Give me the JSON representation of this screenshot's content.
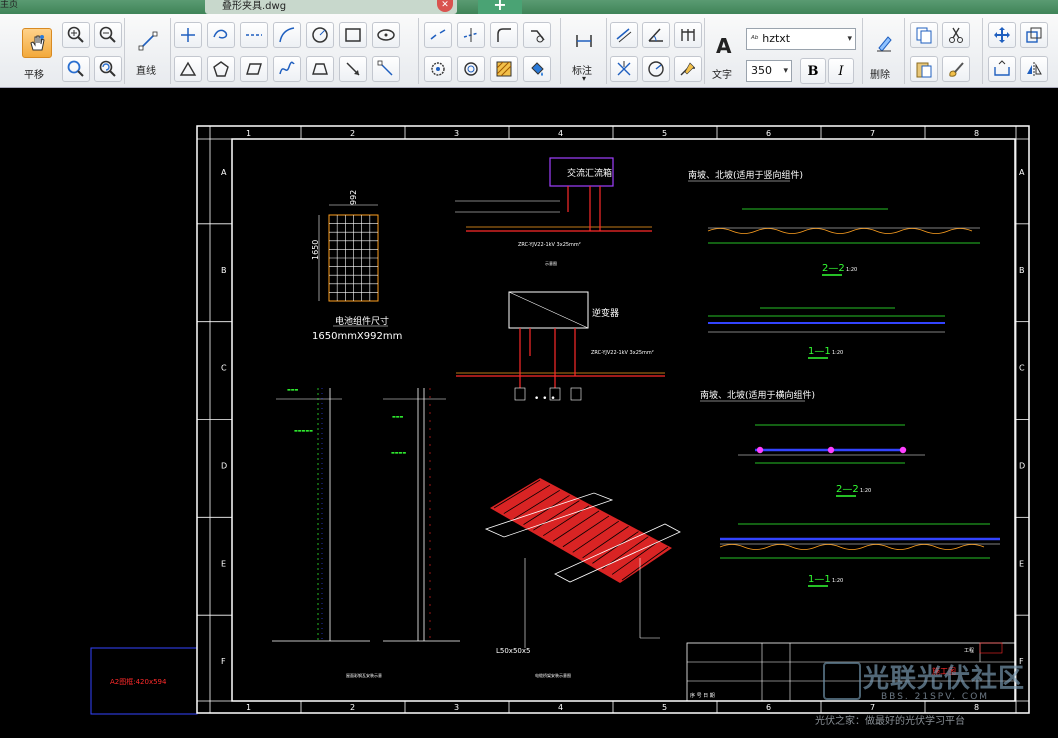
{
  "window": {
    "left_text": "主页",
    "tab_title": "叠形夹具.dwg",
    "close_icon": "close-icon",
    "new_tab_icon": "plus-icon"
  },
  "ribbon": {
    "pan_label": "平移",
    "line_label": "直线",
    "dimension_label": "标注",
    "text_label": "文字",
    "delete_label": "删除",
    "text_style": "hztxt",
    "text_height": "350",
    "bold_label": "B",
    "italic_label": "I"
  },
  "drawing": {
    "col_labels": [
      "1",
      "2",
      "3",
      "4",
      "5",
      "6",
      "7",
      "8"
    ],
    "row_labels": [
      "A",
      "B",
      "C",
      "D",
      "E",
      "F"
    ],
    "panel_dim_width": "992",
    "panel_dim_height": "1650",
    "panel_title": "电池组件尺寸",
    "panel_size": "1650mmX992mm",
    "combiner_label": "交流汇流箱",
    "inverter_label": "逆变器",
    "south_north_longitudinal": "南坡、北坡(适用于竖向组件)",
    "south_north_transverse": "南坡、北坡(适用于横向组件)",
    "section_2_2": "2—2",
    "section_1_1": "1—1",
    "scale_1_20": "1:20",
    "frame_size_label": "A2图框:420x594",
    "cable_1": "ZRC-YJV22-1kV 3x25mm²",
    "cable_2": "ZRC-YJV22-1kV 3x25mm²",
    "angle_label": "L50x50x5",
    "mounting_caption": "屋面彩钢瓦安装示意",
    "tray_caption": "电缆桥架安装示意图",
    "title_block_label": "工程",
    "stamp": "施工图"
  },
  "watermark": {
    "logo_text": "光联光伏社区",
    "url": "BBS. 21SPV. COM",
    "slogan": "光伏之家：做最好的光伏学习平台"
  },
  "colors": {
    "ribbon_bg": "#f0f2f5",
    "canvas_bg": "#000000",
    "title_bar": "#4f9366",
    "cad_red": "#ff2a2a",
    "cad_green": "#33ff33",
    "cad_blue": "#3344ff",
    "cad_orange": "#ffa020",
    "cad_magenta": "#ff40ff",
    "cad_purple_box": "#a040ff"
  }
}
